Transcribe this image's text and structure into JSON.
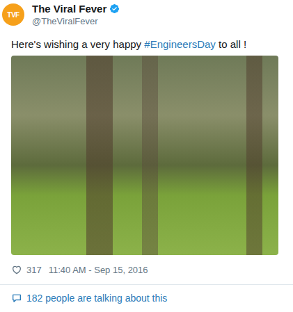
{
  "account": {
    "avatar_text": "TVF",
    "name": "The Viral Fever",
    "verified": true,
    "handle": "@TheViralFever"
  },
  "tweet": {
    "text_before": "Here's wishing a very happy ",
    "hashtag": "#EngineersDay",
    "text_after": " to all !"
  },
  "stats": {
    "likes": "317",
    "timestamp": "11:40 AM - Sep 15, 2016"
  },
  "conversation": {
    "text": "182 people are talking about this"
  }
}
